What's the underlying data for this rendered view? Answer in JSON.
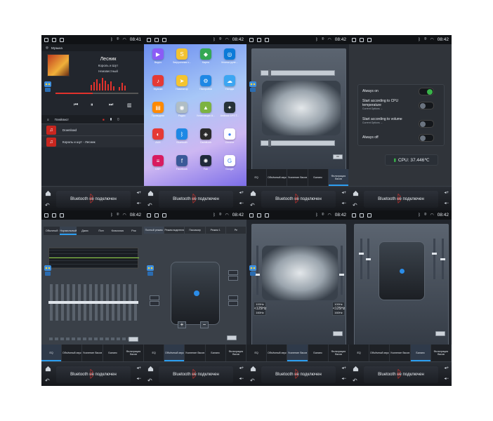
{
  "status": {
    "times": [
      "08:41",
      "08:42",
      "08:42",
      "08:42",
      "08:42",
      "08:42",
      "08:42",
      "08:42"
    ]
  },
  "bottom": {
    "bt_label": "Bluetooth не подключен"
  },
  "music": {
    "header": "Музыка",
    "song": "Лесник",
    "artist": "Король и Шут",
    "album": "Неизвестный",
    "playlist": "Плейлист",
    "tracks": [
      "Download",
      "Король и шут - Лесник"
    ],
    "progress_fraction": 0.45
  },
  "apps": [
    {
      "label": "Видео",
      "color": "#8b5cf6",
      "icon": "▶"
    },
    {
      "label": "Загрузочная с...",
      "color": "#f2c230",
      "icon": "S"
    },
    {
      "label": "Карты",
      "color": "#34a853",
      "icon": "◆"
    },
    {
      "label": "Кнопки руле...",
      "color": "#0b7ad8",
      "icon": "◎"
    },
    {
      "label": "Музыка",
      "color": "#e53935",
      "icon": "♪"
    },
    {
      "label": "Навигатор",
      "color": "#f4c430",
      "icon": "➤"
    },
    {
      "label": "Настройки",
      "color": "#1e88e5",
      "icon": "⚙"
    },
    {
      "label": "Погода",
      "color": "#3ba6f2",
      "icon": "☁"
    },
    {
      "label": "Проводник",
      "color": "#ff8a00",
      "icon": "▤"
    },
    {
      "label": "Радио",
      "color": "#b0bec5",
      "icon": "◉"
    },
    {
      "label": "Установщик А...",
      "color": "#7cb342",
      "icon": "▲"
    },
    {
      "label": "Android GPS T...",
      "color": "#263238",
      "icon": "✦"
    },
    {
      "label": "AUX",
      "color": "#e53935",
      "icon": "◐"
    },
    {
      "label": "Bluetooth",
      "color": "#1e88e5",
      "icon": "ᛒ"
    },
    {
      "label": "CarbitLink",
      "color": "#2b2b2b",
      "icon": "◈"
    },
    {
      "label": "Chrome",
      "color": "#ffffff",
      "icon": "●"
    },
    {
      "label": "DSP",
      "color": "#d81b60",
      "icon": "≡"
    },
    {
      "label": "Facebook",
      "color": "#3b5998",
      "icon": "f"
    },
    {
      "label": "Fan",
      "color": "#1f2a3a",
      "icon": "✺"
    },
    {
      "label": "Google",
      "color": "#ffffff",
      "icon": "G"
    }
  ],
  "seat_panel": {
    "tabs": [
      "EQ",
      "Объёмный звук",
      "Усиление басов",
      "Баланс",
      "Фильтрация басов"
    ],
    "ok": "OK"
  },
  "cpu_panel": {
    "options": [
      {
        "title": "Always on",
        "sub": "",
        "on": true
      },
      {
        "title": "Start according to CPU temperature",
        "sub": "Current Options →",
        "on": false
      },
      {
        "title": "Start according to volume",
        "sub": "Current Options →",
        "on": false
      },
      {
        "title": "Always off",
        "sub": "",
        "on": false
      }
    ],
    "cpu_label": "CPU: 37.446℃"
  },
  "eq_panel": {
    "presets": [
      "Обычный",
      "Нормальный",
      "Джаз",
      "Поп",
      "Классика",
      "Рок"
    ],
    "active": 1,
    "tabs": [
      "EQ",
      "Объёмный звук",
      "Усиление басов",
      "Баланс",
      "Фильтрация басов"
    ]
  },
  "field_panel": {
    "tabs": [
      "Полный режим",
      "Режим водителя",
      "Пассажир",
      "Режим 1",
      "Ре"
    ],
    "plus": "+",
    "minus": "−",
    "tabs_bottom": [
      "EQ",
      "Объёмный звук",
      "Усиление басов",
      "Баланс",
      "Фильтрация басов"
    ]
  },
  "bass_panel": {
    "left_hz": [
      "100Hz",
      "<125Hz",
      "160Hz"
    ],
    "right_hz": [
      "100Hz",
      "<125Hz",
      "160Hz"
    ],
    "tabs": [
      "EQ",
      "Объёмный звук",
      "Усиление басов",
      "Баланс",
      "Фильтрация басов"
    ]
  },
  "filter_panel": {
    "tabs": [
      "EQ",
      "Объёмный звук",
      "Усиление басов",
      "Баланс",
      "Фильтрация басов"
    ]
  }
}
